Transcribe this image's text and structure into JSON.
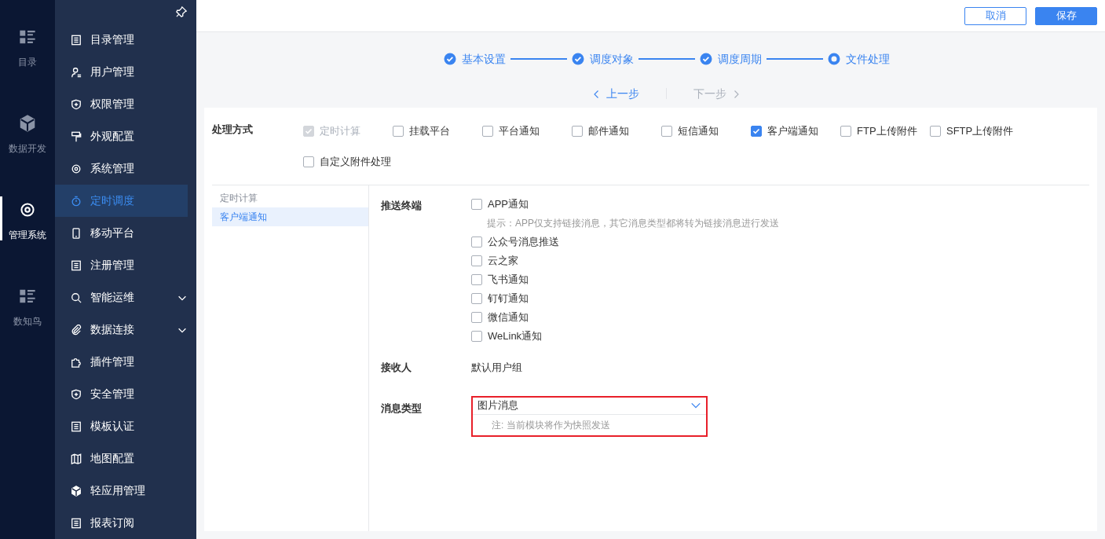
{
  "rail": [
    {
      "label": "目录",
      "selected": false
    },
    {
      "label": "数据开发",
      "selected": false
    },
    {
      "label": "管理系统",
      "selected": true
    },
    {
      "label": "数知鸟",
      "selected": false
    }
  ],
  "nav": [
    {
      "label": "目录管理",
      "selected": false,
      "expandable": false
    },
    {
      "label": "用户管理",
      "selected": false,
      "expandable": false
    },
    {
      "label": "权限管理",
      "selected": false,
      "expandable": false
    },
    {
      "label": "外观配置",
      "selected": false,
      "expandable": false
    },
    {
      "label": "系统管理",
      "selected": false,
      "expandable": false
    },
    {
      "label": "定时调度",
      "selected": true,
      "expandable": false
    },
    {
      "label": "移动平台",
      "selected": false,
      "expandable": false
    },
    {
      "label": "注册管理",
      "selected": false,
      "expandable": false
    },
    {
      "label": "智能运维",
      "selected": false,
      "expandable": true
    },
    {
      "label": "数据连接",
      "selected": false,
      "expandable": true
    },
    {
      "label": "插件管理",
      "selected": false,
      "expandable": false
    },
    {
      "label": "安全管理",
      "selected": false,
      "expandable": false
    },
    {
      "label": "模板认证",
      "selected": false,
      "expandable": false
    },
    {
      "label": "地图配置",
      "selected": false,
      "expandable": false
    },
    {
      "label": "轻应用管理",
      "selected": false,
      "expandable": false
    },
    {
      "label": "报表订阅",
      "selected": false,
      "expandable": false
    }
  ],
  "buttons": [
    {
      "label": "取消",
      "kind": "outline"
    },
    {
      "label": "保存",
      "kind": "primary"
    }
  ],
  "steps": [
    {
      "label": "基本设置",
      "completed": true
    },
    {
      "label": "调度对象",
      "completed": true
    },
    {
      "label": "调度周期",
      "completed": true
    },
    {
      "label": "文件处理",
      "completed": false
    }
  ],
  "step_nav": [
    {
      "label": "上一步",
      "kind": "prev",
      "disabled": false
    },
    {
      "label": "下一步",
      "kind": "next",
      "disabled": true
    }
  ],
  "process": {
    "label": "处理方式",
    "options": [
      {
        "label": "定时计算",
        "checked": true,
        "disabled": true
      },
      {
        "label": "挂载平台",
        "checked": false,
        "disabled": false
      },
      {
        "label": "平台通知",
        "checked": false,
        "disabled": false
      },
      {
        "label": "邮件通知",
        "checked": false,
        "disabled": false
      },
      {
        "label": "短信通知",
        "checked": false,
        "disabled": false
      },
      {
        "label": "客户端通知",
        "checked": true,
        "disabled": false
      },
      {
        "label": "FTP上传附件",
        "checked": false,
        "disabled": false
      },
      {
        "label": "SFTP上传附件",
        "checked": false,
        "disabled": false
      },
      {
        "label": "自定义附件处理",
        "checked": false,
        "disabled": false
      }
    ]
  },
  "side_tabs": [
    {
      "label": "定时计算",
      "selected": false
    },
    {
      "label": "客户端通知",
      "selected": true
    }
  ],
  "push": {
    "label": "推送终端",
    "options": [
      {
        "label": "APP通知",
        "checked": false,
        "hint": "提示：APP仅支持链接消息，其它消息类型都将转为链接消息进行发送"
      },
      {
        "label": "公众号消息推送",
        "checked": false
      },
      {
        "label": "云之家",
        "checked": false
      },
      {
        "label": "飞书通知",
        "checked": false
      },
      {
        "label": "钉钉通知",
        "checked": false
      },
      {
        "label": "微信通知",
        "checked": false
      },
      {
        "label": "WeLink通知",
        "checked": false
      }
    ]
  },
  "receiver": {
    "label": "接收人",
    "value": "默认用户组"
  },
  "message_type": {
    "label": "消息类型",
    "value": "图片消息",
    "note": "注: 当前模块将作为快照发送",
    "highlighted": true
  }
}
